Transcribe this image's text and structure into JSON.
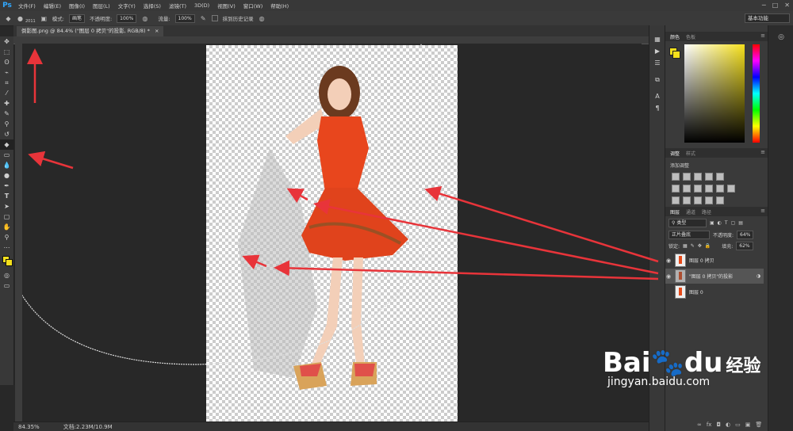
{
  "menubar": {
    "logo": "Ps",
    "items": [
      "文件(F)",
      "编辑(E)",
      "图像(I)",
      "图层(L)",
      "文字(Y)",
      "选择(S)",
      "滤镜(T)",
      "3D(D)",
      "视图(V)",
      "窗口(W)",
      "帮助(H)"
    ],
    "window_controls": [
      "─",
      "□",
      "✕"
    ]
  },
  "options": {
    "brush_size": "2011",
    "mode_label": "模式:",
    "mode_value": "画笔",
    "opacity_label": "不透明度:",
    "opacity_value": "100%",
    "flow_label": "流量:",
    "flow_value": "100%",
    "history_label": "抹到历史记录",
    "workspace": "基本功能"
  },
  "document": {
    "tab_title": "倒影图.png @ 84.4% (\"图层 0 拷贝\"的投影, RGB/8) *",
    "close_glyph": "×",
    "zoom": "84.35%",
    "doc_size": "文档:2.23M/10.9M"
  },
  "panels": {
    "color_tabs": [
      "颜色",
      "色板"
    ],
    "adjust_tabs": [
      "调整",
      "样式"
    ],
    "adjust_title": "添加调整",
    "layers_tabs": [
      "图层",
      "通道",
      "路径"
    ],
    "filter_kind": "类型",
    "blend_mode": "正片叠底",
    "opacity_label": "不透明度:",
    "opacity_value": "64%",
    "lock_label": "锁定:",
    "fill_label": "填充:",
    "fill_value": "62%",
    "layers": [
      {
        "name": "图层 0 拷贝",
        "visible": true,
        "selected": false
      },
      {
        "name": "\"图层 0 拷贝\"的投影",
        "visible": true,
        "selected": true
      },
      {
        "name": "图层 0",
        "visible": false,
        "selected": false
      }
    ],
    "layer_footer_icons": [
      "link-icon",
      "fx-icon",
      "mask-icon",
      "adjust-icon",
      "folder-icon",
      "new-layer-icon",
      "trash-icon"
    ]
  },
  "watermark": {
    "brand": "Bai",
    "brand2": "du",
    "suffix": "经验",
    "url": "jingyan.baidu.com"
  },
  "colors": {
    "foreground": "#f5e01c",
    "arrow": "#e8343a",
    "accent": "#31a8ff"
  }
}
